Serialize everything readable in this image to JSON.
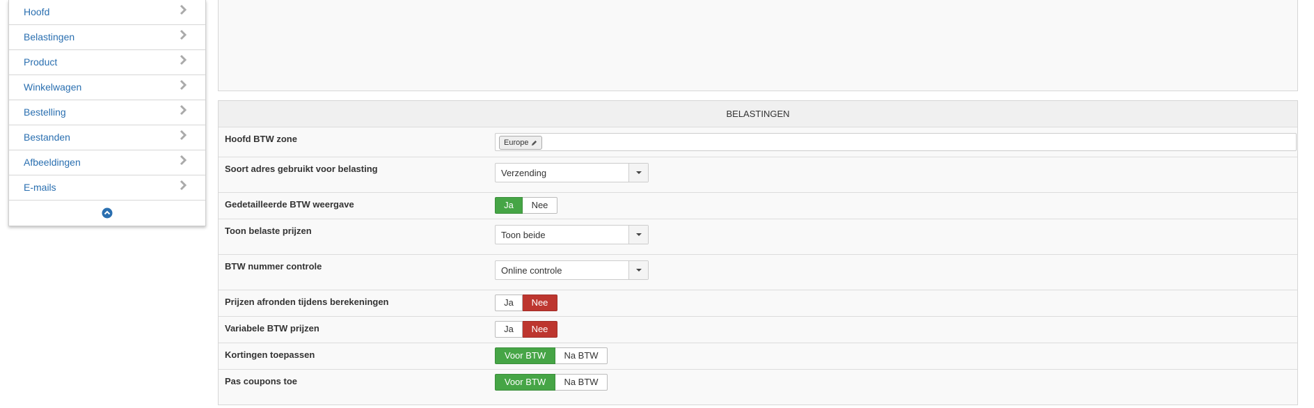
{
  "sidebar": {
    "items": [
      {
        "label": "Hoofd"
      },
      {
        "label": "Belastingen"
      },
      {
        "label": "Product"
      },
      {
        "label": "Winkelwagen"
      },
      {
        "label": "Bestelling"
      },
      {
        "label": "Bestanden"
      },
      {
        "label": "Afbeeldingen"
      },
      {
        "label": "E-mails"
      }
    ]
  },
  "taxes": {
    "title": "BELASTINGEN",
    "main_zone": {
      "label": "Hoofd BTW zone",
      "tag": "Europe"
    },
    "address_type": {
      "label": "Soort adres gebruikt voor belasting",
      "value": "Verzending"
    },
    "detailed_vat": {
      "label": "Gedetailleerde BTW weergave",
      "yes": "Ja",
      "no": "Nee",
      "selected": "Ja"
    },
    "show_taxed_prices": {
      "label": "Toon belaste prijzen",
      "value": "Toon beide"
    },
    "vat_number_check": {
      "label": "BTW nummer controle",
      "value": "Online controle"
    },
    "round_prices": {
      "label": "Prijzen afronden tijdens berekeningen",
      "yes": "Ja",
      "no": "Nee",
      "selected": "Nee"
    },
    "variable_vat": {
      "label": "Variabele BTW prijzen",
      "yes": "Ja",
      "no": "Nee",
      "selected": "Nee"
    },
    "apply_discounts": {
      "label": "Kortingen toepassen",
      "before": "Voor BTW",
      "after": "Na BTW",
      "selected": "Voor BTW"
    },
    "apply_coupons": {
      "label": "Pas coupons toe",
      "before": "Voor BTW",
      "after": "Na BTW",
      "selected": "Voor BTW"
    }
  },
  "colors": {
    "link": "#2a6fb0",
    "green": "#46a546",
    "red": "#bd362f"
  }
}
